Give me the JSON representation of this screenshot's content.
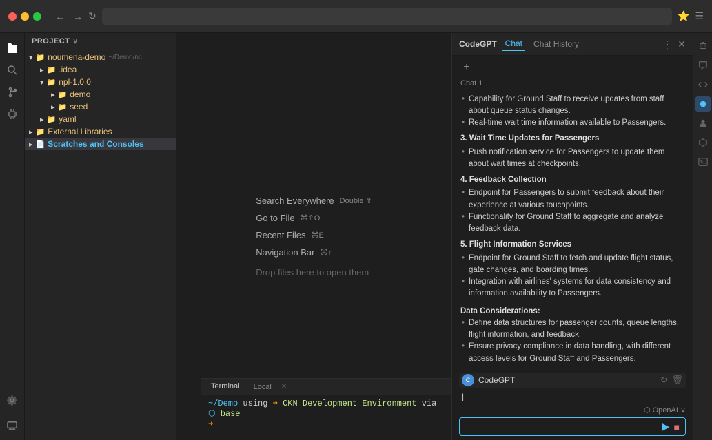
{
  "browser": {
    "address": "",
    "nav_back": "←",
    "nav_forward": "→",
    "refresh": "↻"
  },
  "sidebar": {
    "icons": [
      {
        "name": "files-icon",
        "symbol": "⎘",
        "active": false
      },
      {
        "name": "search-icon",
        "symbol": "🔍",
        "active": false
      },
      {
        "name": "source-control-icon",
        "symbol": "⑂",
        "active": false
      },
      {
        "name": "extensions-icon",
        "symbol": "⊞",
        "active": false
      },
      {
        "name": "more-icon",
        "symbol": "···",
        "active": false
      }
    ],
    "bottom_icons": [
      {
        "name": "settings-icon",
        "symbol": "⚙",
        "active": false
      },
      {
        "name": "accounts-icon",
        "symbol": "👤",
        "active": false
      },
      {
        "name": "remote-icon",
        "symbol": "⌨",
        "active": false
      }
    ]
  },
  "file_tree": {
    "header": "Project",
    "items": [
      {
        "id": "noumena-demo",
        "label": "noumena-demo ~/Demo/nc",
        "indent": 0,
        "type": "folder",
        "expanded": true
      },
      {
        "id": "idea",
        "label": ".idea",
        "indent": 1,
        "type": "folder",
        "expanded": false
      },
      {
        "id": "npl-1.0.0",
        "label": "npl-1.0.0",
        "indent": 1,
        "type": "folder",
        "expanded": true
      },
      {
        "id": "demo",
        "label": "demo",
        "indent": 2,
        "type": "folder",
        "expanded": false
      },
      {
        "id": "seed",
        "label": "seed",
        "indent": 2,
        "type": "folder",
        "expanded": false
      },
      {
        "id": "yaml",
        "label": "yaml",
        "indent": 1,
        "type": "folder",
        "expanded": false
      },
      {
        "id": "external-libraries",
        "label": "External Libraries",
        "indent": 0,
        "type": "folder",
        "expanded": false
      },
      {
        "id": "scratches",
        "label": "Scratches and Consoles",
        "indent": 0,
        "type": "file",
        "expanded": false,
        "active": true
      }
    ]
  },
  "editor": {
    "shortcuts": [
      {
        "label": "Search Everywhere",
        "key": "Double ⇧"
      },
      {
        "label": "Go to File",
        "key": "⌘⇧O"
      },
      {
        "label": "Recent Files",
        "key": "⌘E"
      },
      {
        "label": "Navigation Bar",
        "key": "⌘↑"
      },
      {
        "label": "Drop files here to open them",
        "key": ""
      }
    ]
  },
  "right_panel": {
    "title": "CodeGPT",
    "tabs": [
      {
        "label": "Chat",
        "active": true
      },
      {
        "label": "Chat History",
        "active": false
      }
    ],
    "plus_btn": "+",
    "chat_label": "Chat 1",
    "messages": [
      {
        "type": "content",
        "sections": [
          {
            "bullets": [
              "Capability for Ground Staff to receive updates from staff about queue status changes.",
              "Real-time wait time information available to Passengers."
            ]
          },
          {
            "section_num": "3",
            "title": "Wait Time Updates for Passengers",
            "bullets": [
              "Push notification service for Passengers to update them about wait times at checkpoints."
            ]
          },
          {
            "section_num": "4",
            "title": "Feedback Collection",
            "bullets": [
              "Endpoint for Passengers to submit feedback about their experience at various touchpoints.",
              "Functionality for Ground Staff to aggregate and analyze feedback data."
            ]
          },
          {
            "section_num": "5",
            "title": "Flight Information Services",
            "bullets": [
              "Endpoint for Ground Staff to fetch and update flight status, gate changes, and boarding times.",
              "Integration with airlines' systems for data consistency and information availability to Passengers."
            ]
          },
          {
            "bold_label": "Data Considerations:",
            "bullets": [
              "Define data structures for passenger counts, queue lengths, flight information, and feedback.",
              "Ensure privacy compliance in data handling, with different access levels for Ground Staff and Passengers."
            ]
          }
        ]
      }
    ],
    "assistant": {
      "name": "CodeGPT",
      "icon_letter": "C"
    },
    "provider": "OpenAI",
    "input_placeholder": "I",
    "send_icon": "▶",
    "stop_icon": "■"
  },
  "far_right_icons": [
    {
      "name": "robot-icon",
      "symbol": "🤖",
      "active": false
    },
    {
      "name": "chat-icon",
      "symbol": "💬",
      "active": false
    },
    {
      "name": "code-icon",
      "symbol": "</>",
      "active": false
    },
    {
      "name": "active-icon",
      "symbol": "●",
      "active": true
    },
    {
      "name": "person-icon",
      "symbol": "👤",
      "active": false
    },
    {
      "name": "api-icon",
      "symbol": "⬡",
      "active": false
    },
    {
      "name": "terminal-icon",
      "symbol": "▸",
      "active": false
    }
  ],
  "terminal": {
    "tabs": [
      {
        "label": "Terminal",
        "active": true
      },
      {
        "label": "Local",
        "active": false
      }
    ],
    "prompt_text": "~/Demo",
    "command_text": "using",
    "env_arrow": "➜",
    "env_name": "CKN Development Environment",
    "env_via": "via",
    "env_conda": "⬡",
    "env_base": "base",
    "cursor": " "
  }
}
